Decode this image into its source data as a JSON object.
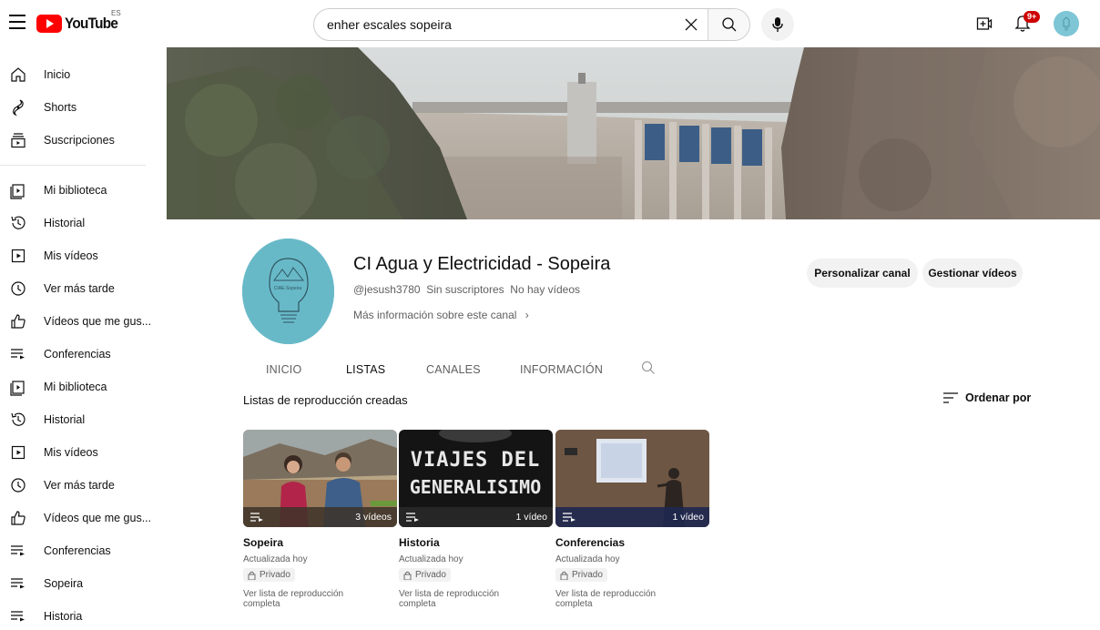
{
  "header": {
    "logo_text": "YouTube",
    "country_code": "ES",
    "search_query": "enher escales sopeira",
    "notifications_badge": "9+"
  },
  "sidebar": {
    "group1": [
      {
        "label": "Inicio",
        "icon": "home-icon"
      },
      {
        "label": "Shorts",
        "icon": "shorts-icon"
      },
      {
        "label": "Suscripciones",
        "icon": "subscriptions-icon"
      }
    ],
    "group2": [
      {
        "label": "Mi biblioteca",
        "icon": "library-icon"
      },
      {
        "label": "Historial",
        "icon": "history-icon"
      },
      {
        "label": "Mis vídeos",
        "icon": "my-videos-icon"
      },
      {
        "label": "Ver más tarde",
        "icon": "watch-later-icon"
      },
      {
        "label": "Vídeos que me gus...",
        "icon": "liked-icon"
      },
      {
        "label": "Conferencias",
        "icon": "playlist-icon"
      },
      {
        "label": "Mi biblioteca",
        "icon": "library-icon"
      },
      {
        "label": "Historial",
        "icon": "history-icon"
      },
      {
        "label": "Mis vídeos",
        "icon": "my-videos-icon"
      },
      {
        "label": "Ver más tarde",
        "icon": "watch-later-icon"
      },
      {
        "label": "Vídeos que me gus...",
        "icon": "liked-icon"
      },
      {
        "label": "Conferencias",
        "icon": "playlist-icon"
      },
      {
        "label": "Sopeira",
        "icon": "playlist-icon"
      },
      {
        "label": "Historia",
        "icon": "playlist-icon"
      }
    ]
  },
  "channel": {
    "name": "CI Agua y Electricidad - Sopeira",
    "handle": "@jesush3780",
    "subscribers": "Sin suscriptores",
    "videos": "No hay vídeos",
    "more_info": "Más información sobre este canal",
    "customize_label": "Personalizar canal",
    "manage_label": "Gestionar vídeos",
    "avatar_text": "CIAE-Sopeira"
  },
  "tabs": [
    {
      "label": "INICIO",
      "active": false
    },
    {
      "label": "LISTAS",
      "active": true
    },
    {
      "label": "CANALES",
      "active": false
    },
    {
      "label": "INFORMACIÓN",
      "active": false
    }
  ],
  "section": {
    "title": "Listas de reproducción creadas",
    "sort_label": "Ordenar por"
  },
  "playlists": [
    {
      "title": "Sopeira",
      "count": "3 vídeos",
      "updated": "Actualizada hoy",
      "privacy": "Privado",
      "view_all": "Ver lista de reproducción completa",
      "thumb_text": ""
    },
    {
      "title": "Historia",
      "count": "1 vídeo",
      "updated": "Actualizada hoy",
      "privacy": "Privado",
      "view_all": "Ver lista de reproducción completa",
      "thumb_text_1": "VIAJES DEL",
      "thumb_text_2": "GENERALISIMO"
    },
    {
      "title": "Conferencias",
      "count": "1 vídeo",
      "updated": "Actualizada hoy",
      "privacy": "Privado",
      "view_all": "Ver lista de reproducción completa",
      "thumb_text": ""
    }
  ],
  "colors": {
    "brand_red": "#ff0000",
    "badge_red": "#cc0000",
    "avatar_teal": "#68b9c8"
  }
}
